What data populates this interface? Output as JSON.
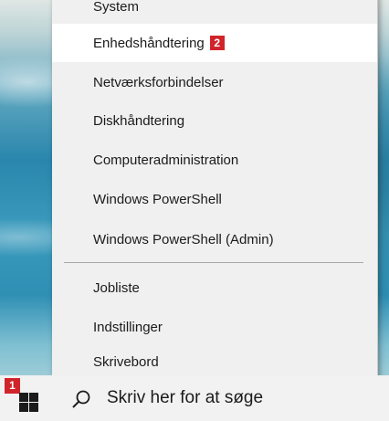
{
  "menu": {
    "items": [
      {
        "label": "System"
      },
      {
        "label": "Enhedshåndtering",
        "badge": "2",
        "highlighted": true
      },
      {
        "label": "Netværksforbindelser"
      },
      {
        "label": "Diskhåndtering"
      },
      {
        "label": "Computeradministration"
      },
      {
        "label": "Windows PowerShell"
      },
      {
        "label": "Windows PowerShell (Admin)"
      },
      {
        "label": "Jobliste"
      },
      {
        "label": "Indstillinger"
      },
      {
        "label": "Skrivebord"
      }
    ]
  },
  "taskbar": {
    "start_badge": "1",
    "start_icon": "windows-logo-icon",
    "search_icon": "search-icon",
    "search_placeholder": "Skriv her for at søge"
  },
  "colors": {
    "badge": "#d0242b",
    "menu_bg": "#f0f0f0",
    "highlight": "#ffffff"
  }
}
